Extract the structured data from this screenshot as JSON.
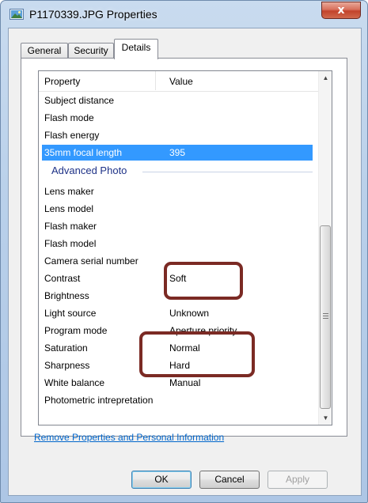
{
  "window": {
    "title": "P1170339.JPG Properties",
    "close_label": "x"
  },
  "tabs": [
    {
      "label": "General",
      "active": false
    },
    {
      "label": "Security",
      "active": false
    },
    {
      "label": "Details",
      "active": true
    }
  ],
  "list": {
    "columns": {
      "property": "Property",
      "value": "Value"
    },
    "rows_before": [
      {
        "property": "Subject distance",
        "value": ""
      },
      {
        "property": "Flash mode",
        "value": ""
      },
      {
        "property": "Flash energy",
        "value": ""
      },
      {
        "property": "35mm focal length",
        "value": "395",
        "selected": true
      }
    ],
    "group_label": "Advanced Photo",
    "rows_after": [
      {
        "property": "Lens maker",
        "value": ""
      },
      {
        "property": "Lens model",
        "value": ""
      },
      {
        "property": "Flash maker",
        "value": ""
      },
      {
        "property": "Flash model",
        "value": ""
      },
      {
        "property": "Camera serial number",
        "value": ""
      },
      {
        "property": "Contrast",
        "value": "Soft"
      },
      {
        "property": "Brightness",
        "value": ""
      },
      {
        "property": "Light source",
        "value": "Unknown"
      },
      {
        "property": "Program mode",
        "value": "Aperture priority"
      },
      {
        "property": "Saturation",
        "value": "Normal"
      },
      {
        "property": "Sharpness",
        "value": "Hard"
      },
      {
        "property": "White balance",
        "value": "Manual"
      },
      {
        "property": "Photometric intrepretation",
        "value": ""
      }
    ]
  },
  "remove_link": "Remove Properties and Personal Information",
  "buttons": {
    "ok": "OK",
    "cancel": "Cancel",
    "apply": "Apply"
  },
  "colors": {
    "selection": "#3399ff",
    "group_label": "#1e3287",
    "annotation": "#7b2a24",
    "link": "#0066cc"
  },
  "icons": {
    "title": "image-file-icon",
    "scroll_up": "triangle-up",
    "scroll_down": "triangle-down"
  }
}
